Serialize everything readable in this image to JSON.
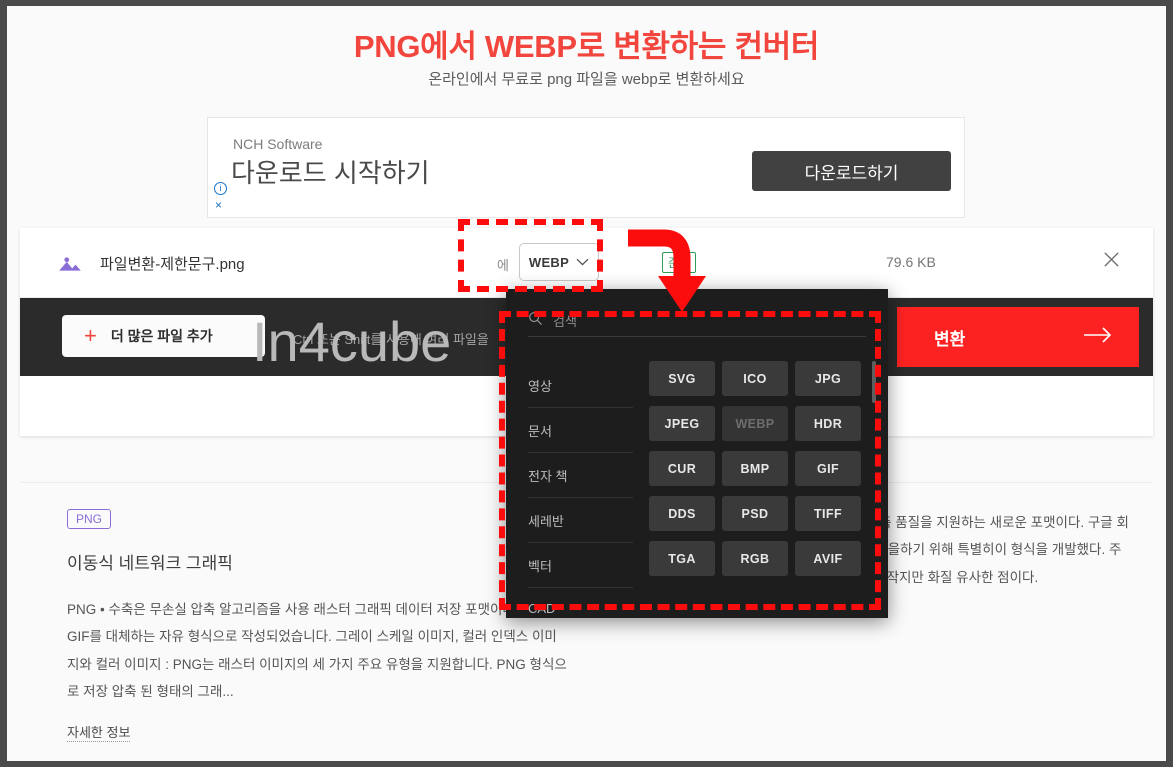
{
  "page": {
    "title": "PNG에서 WEBP로 변환하는 컨버터",
    "subtitle": "온라인에서 무료로 png 파일을 webp로 변환하세요",
    "watermark": "In4cube"
  },
  "ad": {
    "brand": "NCH Software",
    "headline": "다운로드 시작하기",
    "cta_label": "다운로드하기",
    "info_icon": "info-icon",
    "close_icon": "×"
  },
  "file_row": {
    "icon": "image-file-icon",
    "name": "파일변환-제한문구.png",
    "to_label": "에",
    "target_format": "WEBP",
    "chevron": "chevron-down-icon",
    "status_badge": "준비",
    "size": "79.6 KB",
    "close_icon": "close-icon"
  },
  "action_bar": {
    "add_files_label": "더 많은 파일 추가",
    "plus_icon": "+",
    "hint": "Ctrl 또는 Shift를 사용해 여러 파일을",
    "convert_label": "변환",
    "arrow_icon": "arrow-right-icon"
  },
  "dropdown": {
    "search_placeholder": "검색",
    "search_icon": "search-icon",
    "categories": [
      {
        "label": "영상"
      },
      {
        "label": "문서"
      },
      {
        "label": "전자 책"
      },
      {
        "label": "세레반"
      },
      {
        "label": "벡터"
      },
      {
        "label": "CAD"
      }
    ],
    "formats": [
      {
        "label": "SVG",
        "disabled": false
      },
      {
        "label": "ICO",
        "disabled": false
      },
      {
        "label": "JPG",
        "disabled": false
      },
      {
        "label": "JPEG",
        "disabled": false
      },
      {
        "label": "WEBP",
        "disabled": true
      },
      {
        "label": "HDR",
        "disabled": false
      },
      {
        "label": "CUR",
        "disabled": false
      },
      {
        "label": "BMP",
        "disabled": false
      },
      {
        "label": "GIF",
        "disabled": false
      },
      {
        "label": "DDS",
        "disabled": false
      },
      {
        "label": "PSD",
        "disabled": false
      },
      {
        "label": "TIFF",
        "disabled": false
      },
      {
        "label": "TGA",
        "disabled": false
      },
      {
        "label": "RGB",
        "disabled": false
      },
      {
        "label": "AVIF",
        "disabled": false
      }
    ]
  },
  "info": {
    "left": {
      "tag": "PNG",
      "heading": "이동식 네트워크 그래픽",
      "body": "PNG • 수축은 무손실 압축 알고리즘을 사용 래스터 그래픽 데이터 저장 포맷이다. PNG는 GIF를 대체하는 자유 형식으로 작성되었습니다. 그레이 스케일 이미지, 컬러 인덱스 이미지와 컬러 이미지 : PNG는 래스터 이미지의 세 가지 주요 유형을 지원합니다. PNG 형식으로 저장 압축 된 형태의 그래...",
      "more_label": "자세한 정보"
    },
    "right": {
      "body": "이는 인터넷에서 이미지의 무손실 및 손실 압축 품질을 지원하는 새로운 포맷이다. 구글 회사는 온라인으로 신속하고 편리하게 가능한 일을하기 위해 특별히이 형식을 개발했다. 주요 이점은 파일 크기가 다른 화상 포맷에 비해 작지만 화질 유사한 점이다."
    }
  },
  "colors": {
    "brand_red": "#f2453d",
    "convert_red": "#fd2222",
    "annotation_red": "#fc0d0d",
    "dark_bar": "#2b2b2b",
    "panel_dark": "#1d1d1d",
    "tag_purple": "#8a6ed6",
    "status_green": "#2e9e5b"
  }
}
